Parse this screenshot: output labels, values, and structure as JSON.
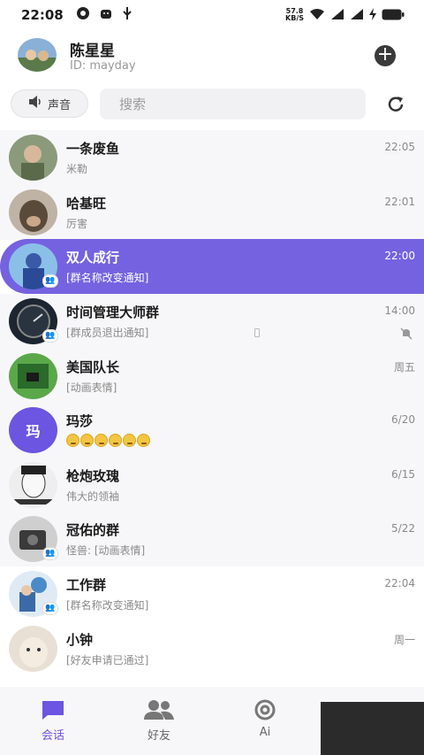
{
  "status": {
    "time": "22:08",
    "speed_top": "57.8",
    "speed_bottom": "KB/S"
  },
  "profile": {
    "name": "陈星星",
    "id": "ID: mayday"
  },
  "toolbar": {
    "sound_label": "声音",
    "search_placeholder": "搜索"
  },
  "conversations": [
    {
      "name": "一条废鱼",
      "message": "米勒",
      "time": "22:05",
      "group": false,
      "avatar_color": "#7a8a6a"
    },
    {
      "name": "哈基旺",
      "message": "厉害",
      "time": "22:01",
      "group": false,
      "avatar_color": "#6b5a4a"
    },
    {
      "name": "双人成行",
      "message": "[群名称改变通知]",
      "time": "22:00",
      "group": true,
      "active": true,
      "avatar_color": "#4a7ab8"
    },
    {
      "name": "时间管理大师群",
      "message": "[群成员退出通知]",
      "time": "14:00",
      "group": true,
      "muted": true,
      "avatar_color": "#1c2530"
    },
    {
      "name": "美国队长",
      "message": "[动画表情]",
      "time": "周五",
      "group": false,
      "avatar_color": "#4a9a3a"
    },
    {
      "name": "玛莎",
      "message": "",
      "time": "6/20",
      "group": false,
      "letter": "玛",
      "emoji_count": 6
    },
    {
      "name": "枪炮玫瑰",
      "message": "伟大的领袖",
      "time": "6/15",
      "group": false,
      "avatar_color": "#e0e0e0"
    },
    {
      "name": "冠佑的群",
      "message": "怪兽: [动画表情]",
      "time": "5/22",
      "group": true,
      "avatar_color": "#5a5a5a"
    },
    {
      "name": "工作群",
      "message": "[群名称改变通知]",
      "time": "22:04",
      "group": true,
      "avatar_color": "#4a8ac8"
    },
    {
      "name": "小钟",
      "message": "[好友申请已通过]",
      "time": "周一",
      "group": false,
      "avatar_color": "#c8b8a0"
    }
  ],
  "tabs": [
    {
      "label": "会话",
      "icon": "chat-icon",
      "active": true
    },
    {
      "label": "好友",
      "icon": "friends-icon",
      "active": false
    },
    {
      "label": "Ai",
      "icon": "at-icon",
      "active": false
    }
  ],
  "colors": {
    "accent": "#6c55e0",
    "active_row": "#7562e0"
  }
}
